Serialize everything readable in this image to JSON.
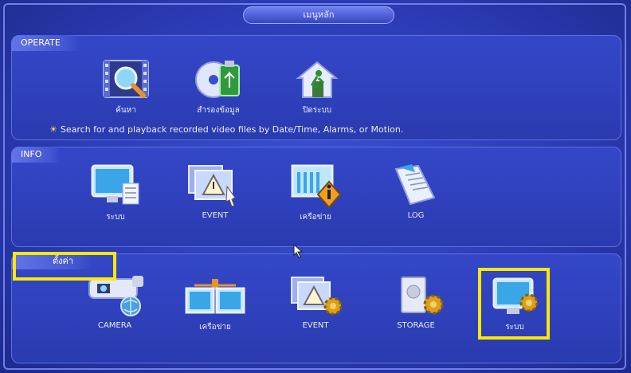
{
  "window": {
    "title": "เมนูหลัก"
  },
  "operate": {
    "label": "OPERATE",
    "items": [
      {
        "label": "ค้นหา",
        "icon": "search-video-icon"
      },
      {
        "label": "สำรองข้อมูล",
        "icon": "backup-disc-usb-icon"
      },
      {
        "label": "ปิดระบบ",
        "icon": "shutdown-exit-icon"
      }
    ],
    "hint": "Search for and playback recorded video files by Date/Time, Alarms, or Motion."
  },
  "info": {
    "label": "INFO",
    "items": [
      {
        "label": "ระบบ",
        "icon": "system-info-monitor-icon"
      },
      {
        "label": "EVENT",
        "icon": "event-warning-icon"
      },
      {
        "label": "เครือข่าย",
        "icon": "network-info-icon"
      },
      {
        "label": "LOG",
        "icon": "log-book-icon"
      }
    ]
  },
  "setting": {
    "label": "ตั้งค่า",
    "items": [
      {
        "label": "CAMERA",
        "icon": "camera-setting-icon"
      },
      {
        "label": "เครือข่าย",
        "icon": "network-setting-icon"
      },
      {
        "label": "EVENT",
        "icon": "event-setting-icon"
      },
      {
        "label": "STORAGE",
        "icon": "storage-setting-icon"
      },
      {
        "label": "ระบบ",
        "icon": "system-setting-icon"
      }
    ]
  },
  "colors": {
    "highlight": "#ffe800",
    "background": "#2b3cb6"
  }
}
